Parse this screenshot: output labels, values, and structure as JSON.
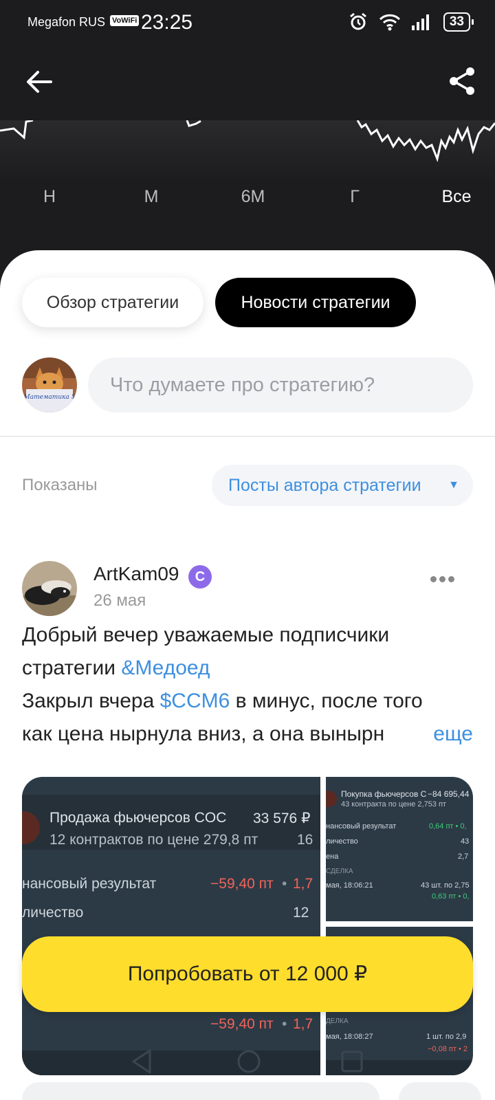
{
  "status_bar": {
    "carrier": "Megafon RUS",
    "vowifi": "VoWiFi",
    "time": "23:25",
    "battery": "33",
    "icons": [
      "alarm-icon",
      "wifi-icon",
      "signal-icon",
      "battery-icon"
    ]
  },
  "header": {
    "back_icon": "arrow-left-icon",
    "share_icon": "share-icon"
  },
  "periods": {
    "items": [
      "Н",
      "М",
      "6М",
      "Г",
      "Все"
    ],
    "active": "Все"
  },
  "tabs": {
    "overview": "Обзор стратегии",
    "news": "Новости стратегии",
    "active": "news"
  },
  "comment": {
    "placeholder": "Что думаете про стратегию?",
    "avatar_caption": "Математика 5"
  },
  "filter": {
    "label": "Показаны",
    "selected": "Посты автора стратегии"
  },
  "post": {
    "author": "ArtKam09",
    "badge": "C",
    "date": "26 мая",
    "line1": "Добрый вечер уважаемые подписчики",
    "line2_text": "стратегии ",
    "line2_link": "&Медоед",
    "line3_before": "Закрыл вчера ",
    "line3_link": "$CCM6",
    "line3_after": " в минус, после того",
    "line4": "как цена нырнула вниз, а она вынырн",
    "more": "еще"
  },
  "screenshots": {
    "main": {
      "title": "Продажа фьючерсов COC",
      "amount": "33 576 ₽",
      "subtitle": "12 контрактов по цене 279,8 пт",
      "subtitle_tail": "16",
      "row1_label": "нансовый результат",
      "row1_value": "−59,40 пт",
      "row1_tail": "1,7",
      "row2_label": "личество",
      "row2_value": "12",
      "bottom_value": "−59,40 пт",
      "bottom_tail": "1,7"
    },
    "side1": {
      "title": "Покупка фьючерсов С",
      "amount": "−84 695,44",
      "subtitle": "43 контракта по цене 2,753 пт",
      "row1_label": "нансовый результат",
      "row1_value": "0,64 пт • 0,",
      "row2_label": "личество",
      "row2_value": "43",
      "row3_label": "ена",
      "row3_value": "2,7",
      "section": "СДЕЛКА",
      "deal_date": "мая, 18:06:21",
      "deal_info": "43 шт. по 2,75",
      "deal_result": "0,63 пт • 0,"
    },
    "side2": {
      "section": "ДЕЛКА",
      "deal_date": "мая, 18:08:27",
      "deal_info": "1 шт. по 2,9",
      "deal_result": "−0,08 пт • 2"
    }
  },
  "cta": {
    "label": "Попробовать от 12 000 ₽"
  },
  "colors": {
    "accent_blue": "#3d8fe0",
    "cta_yellow": "#fedd2d",
    "badge_purple": "#8d6be8",
    "negative_red": "#f0645a",
    "positive_green": "#3ccc7a"
  }
}
